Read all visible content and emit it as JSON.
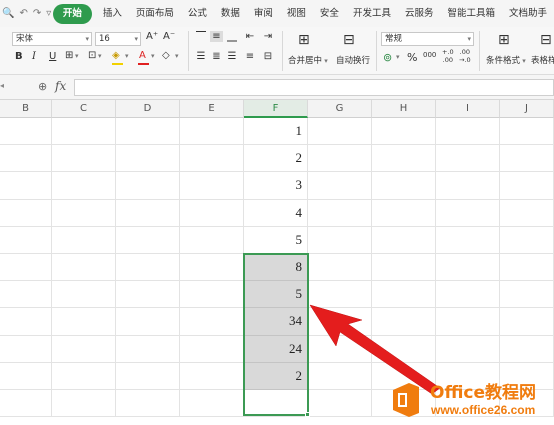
{
  "menubar": {
    "quick_access": [
      "🔍",
      "↶",
      "↷",
      "▿"
    ],
    "tabs": [
      "开始",
      "插入",
      "页面布局",
      "公式",
      "数据",
      "审阅",
      "视图",
      "安全",
      "开发工具",
      "云服务",
      "智能工具箱",
      "文档助手"
    ],
    "active_tab": "开始"
  },
  "ribbon": {
    "font_name": "宋体",
    "font_size": "16",
    "grow_font": "A⁺",
    "shrink_font": "A⁻",
    "bold": "B",
    "italic": "I",
    "underline": "U",
    "merge_center_label": "合并居中",
    "wrap_text_label": "自动换行",
    "number_format": "常规",
    "percent": "%",
    "thousands": "000",
    "inc_decimal": "+.0\n.00",
    "dec_decimal": ".00\n→.0",
    "cond_format_label": "条件格式",
    "table_style_label": "表格样"
  },
  "formula_bar": {
    "fx_label": "fx",
    "value": ""
  },
  "grid": {
    "columns": [
      "B",
      "C",
      "D",
      "E",
      "F",
      "G",
      "H",
      "I",
      "J"
    ],
    "selected_column": "F",
    "f_values": [
      "1",
      "2",
      "3",
      "4",
      "5",
      "8",
      "5",
      "34",
      "24",
      "2",
      ""
    ]
  },
  "colors": {
    "accent": "#2e9b4d",
    "selection": "#3c9a54",
    "highlight": "#d9d9d9",
    "arrow": "#e41d1d",
    "logo": "#f07c0e"
  },
  "logo": {
    "brand": "Office教程网",
    "site": "www.office26.com"
  }
}
